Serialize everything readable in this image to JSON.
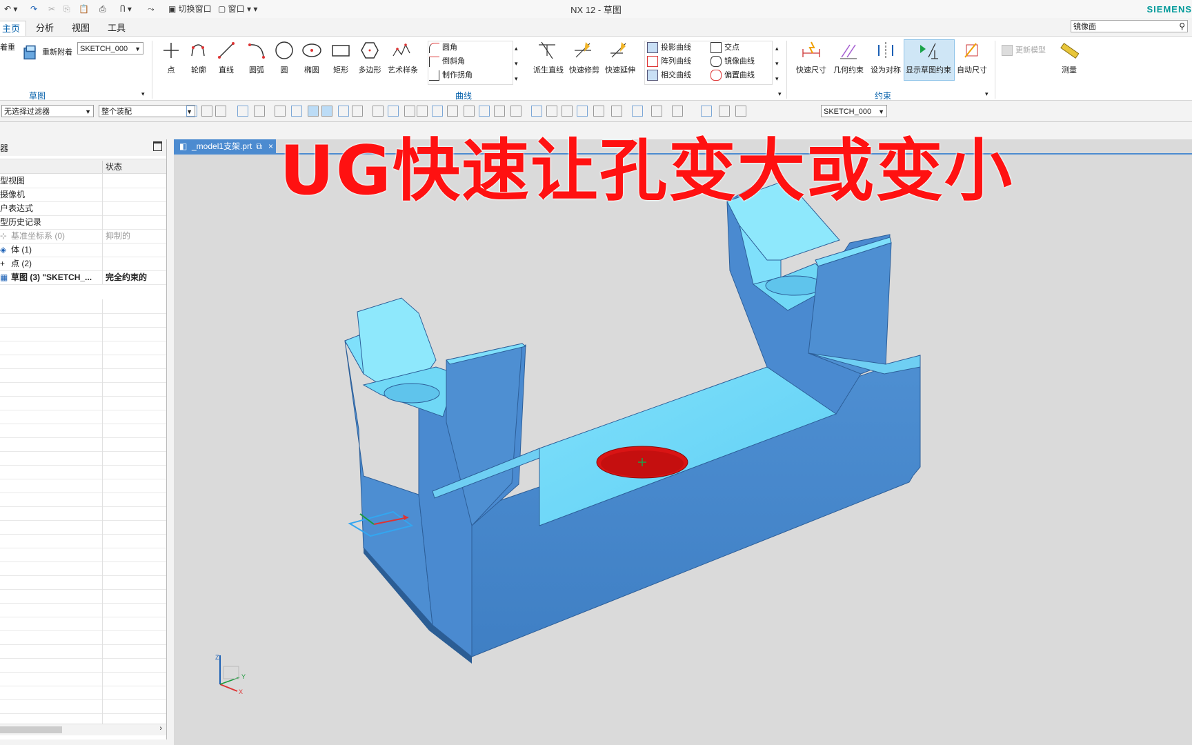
{
  "window": {
    "title": "NX 12 - 草图",
    "brand": "SIEMENS"
  },
  "quick_access": {
    "switch_window": "切换窗口",
    "window_menu": "窗口"
  },
  "tabs": [
    "主页",
    "分析",
    "视图",
    "工具"
  ],
  "ribbon_search": "镜像面",
  "ribbon": {
    "sketch_group": {
      "label": "草图",
      "attach_label": "着重",
      "reattach": "重新附着",
      "sketch_combo": "SKETCH_000"
    },
    "curve_group": {
      "label": "曲线",
      "buttons": [
        "点",
        "轮廓",
        "直线",
        "圆弧",
        "圆",
        "椭圆",
        "矩形",
        "多边形",
        "艺术样条"
      ],
      "small_items": [
        "圆角",
        "倒斜角",
        "制作拐角"
      ],
      "trim_buttons": [
        "派生直线",
        "快速修剪",
        "快速延伸"
      ],
      "curve_items_1": [
        "投影曲线",
        "阵列曲线",
        "相交曲线"
      ],
      "curve_items_2": [
        "交点",
        "镜像曲线",
        "偏置曲线"
      ]
    },
    "constraint_group": {
      "label": "约束",
      "buttons": [
        "快速尺寸",
        "几何约束",
        "设为对称",
        "显示草图约束",
        "自动尺寸"
      ]
    },
    "other": {
      "update_model": "更新模型",
      "measure": "测量"
    }
  },
  "cmdbar": {
    "filter": "无选择过滤器",
    "scope": "整个装配",
    "sketch_combo": "SKETCH_000"
  },
  "navigator": {
    "header": "器",
    "col_name": "",
    "col_status": "状态",
    "rows": [
      {
        "name": "型视图",
        "status": ""
      },
      {
        "name": "摄像机",
        "status": ""
      },
      {
        "name": "户表达式",
        "status": ""
      },
      {
        "name": "型历史记录",
        "status": ""
      },
      {
        "name": "基准坐标系 (0)",
        "status": "抑制的"
      },
      {
        "name": "体 (1)",
        "status": ""
      },
      {
        "name": "点 (2)",
        "status": ""
      },
      {
        "name": "草图 (3) \"SKETCH_...",
        "status": "完全约束的"
      }
    ]
  },
  "document_tab": "_model1支架.prt",
  "overlay_title": "UG快速让孔变大或变小",
  "triad": {
    "z": "Z",
    "y": "Y",
    "x": "X"
  },
  "colors": {
    "accent": "#0a64ad",
    "part_light": "#6fd4f6",
    "part_dark": "#4a8fd0",
    "hole_highlight": "#dd1111",
    "overlay_text": "#ff1111"
  }
}
